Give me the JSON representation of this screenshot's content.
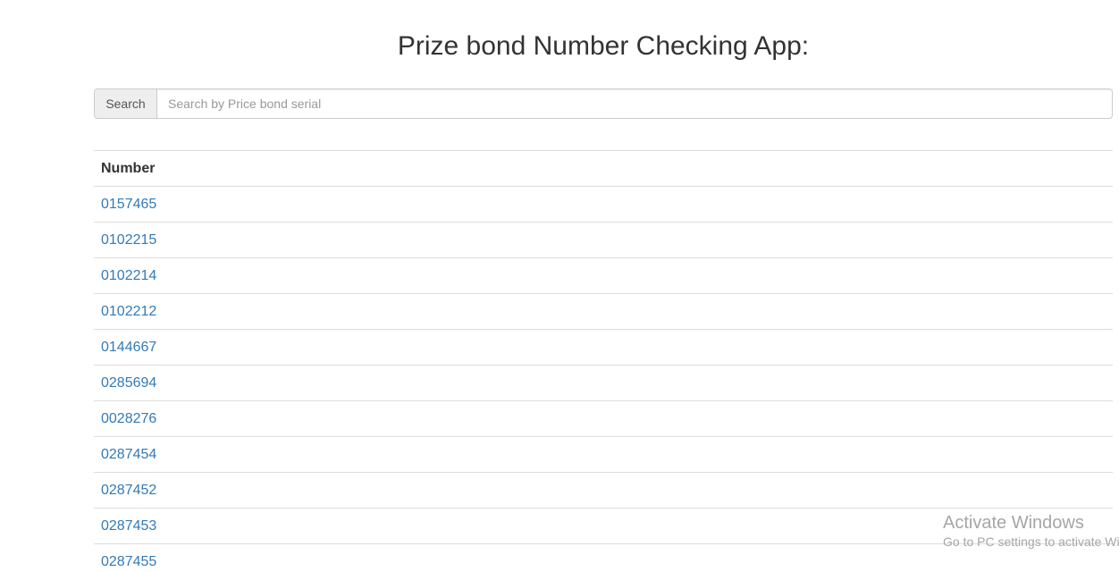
{
  "header": {
    "title": "Prize bond Number Checking App:"
  },
  "search": {
    "addon_label": "Search",
    "placeholder": "Search by Price bond serial",
    "value": ""
  },
  "table": {
    "column_header": "Number",
    "rows": [
      "0157465",
      "0102215",
      "0102214",
      "0102212",
      "0144667",
      "0285694",
      "0028276",
      "0287454",
      "0287452",
      "0287453",
      "0287455"
    ]
  },
  "watermark": {
    "title": "Activate Windows",
    "subtitle": "Go to PC settings to activate Windows."
  },
  "colors": {
    "link": "#337ab7",
    "text": "#333333",
    "border": "#dddddd",
    "addon_bg": "#eeeeee",
    "watermark": "#a6a6a6"
  }
}
